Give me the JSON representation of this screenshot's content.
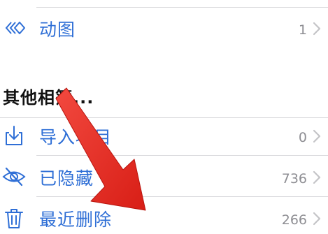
{
  "accent_color": "#2f6fd6",
  "annotation_color": "#e8261c",
  "media_types": {
    "items": [
      {
        "label": "动图",
        "count": "1",
        "icon": "animated-icon"
      }
    ]
  },
  "other_albums": {
    "title": "其他相簿...",
    "items": [
      {
        "label": "导入项目",
        "count": "0",
        "icon": "import-icon"
      },
      {
        "label": "已隐藏",
        "count": "736",
        "icon": "hidden-eye-icon"
      },
      {
        "label": "最近删除",
        "count": "266",
        "icon": "trash-icon"
      }
    ]
  }
}
